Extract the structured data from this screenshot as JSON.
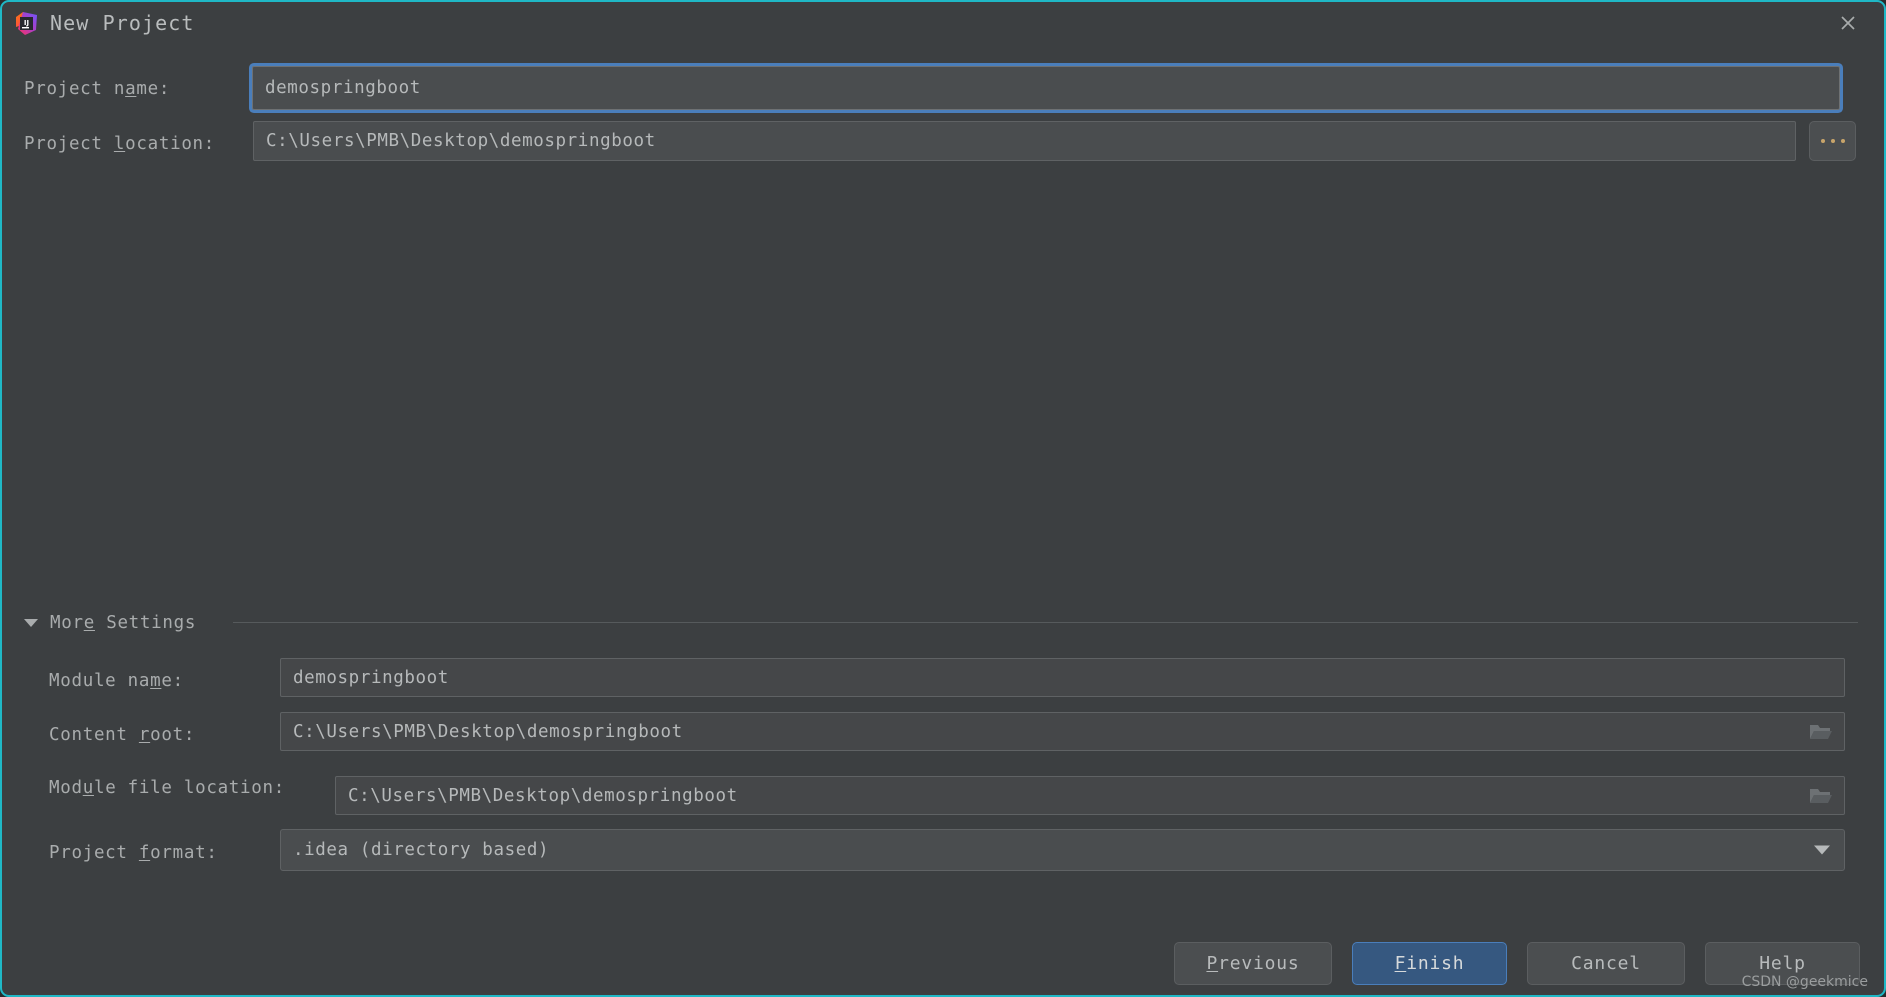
{
  "window": {
    "title": "New Project",
    "logo_icon": "intellij-idea-logo",
    "logo_text": "IJ",
    "close_icon": "close-icon",
    "accent_border_color": "#1fb8c6",
    "background_color": "#3c3f41"
  },
  "form": {
    "project_name": {
      "label_before": "Project n",
      "label_mnemonic": "a",
      "label_after": "me:",
      "label_full": "Project name:",
      "value": "demospringboot",
      "focused": true
    },
    "project_location": {
      "label_before": "Project ",
      "label_mnemonic": "l",
      "label_after": "ocation:",
      "label_full": "Project location:",
      "value": "C:\\Users\\PMB\\Desktop\\demospringboot",
      "browse_button": {
        "name": "browse-ellipsis-button",
        "label": "..."
      }
    }
  },
  "more_settings": {
    "title_before": "Mor",
    "title_mnemonic": "e",
    "title_after": " Settings",
    "title_full": "More Settings",
    "expanded": true,
    "toggle_icon": "triangle-down-icon",
    "rows": {
      "module_name": {
        "label_before": "Module na",
        "label_mnemonic": "m",
        "label_after": "e:",
        "label_full": "Module name:",
        "value": "demospringboot"
      },
      "content_root": {
        "label_before": "Content ",
        "label_mnemonic": "r",
        "label_after": "oot:",
        "label_full": "Content root:",
        "value": "C:\\Users\\PMB\\Desktop\\demospringboot",
        "trailing_icon": "folder-open-icon"
      },
      "module_file_location": {
        "label_before": "Mod",
        "label_mnemonic": "u",
        "label_after": "le file location:",
        "label_full": "Module file location:",
        "value": "C:\\Users\\PMB\\Desktop\\demospringboot",
        "trailing_icon": "folder-open-icon"
      },
      "project_format": {
        "label_before": "Project ",
        "label_mnemonic": "f",
        "label_after": "ormat:",
        "label_full": "Project format:",
        "value": ".idea (directory based)",
        "dropdown_icon": "chevron-down-icon",
        "options": [
          ".idea (directory based)"
        ]
      }
    }
  },
  "footer": {
    "previous": {
      "before": "",
      "mnemonic": "P",
      "after": "revious",
      "full": "Previous"
    },
    "finish": {
      "before": "",
      "mnemonic": "F",
      "after": "inish",
      "full": "Finish",
      "primary": true,
      "color": "#365880"
    },
    "cancel": {
      "full": "Cancel"
    },
    "help": {
      "full": "Help"
    }
  },
  "watermark": {
    "text": "CSDN @geekmice"
  }
}
